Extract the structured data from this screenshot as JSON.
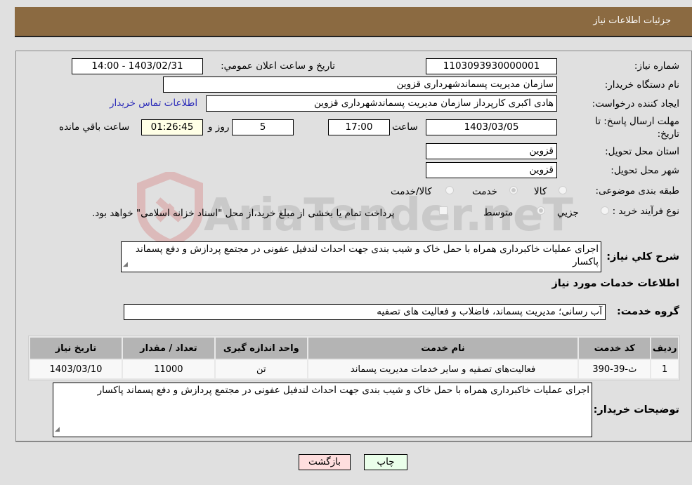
{
  "header": {
    "title": "جزئیات اطلاعات نیاز"
  },
  "form": {
    "need_number": {
      "label": "شماره نیاز:",
      "value": "1103093930000001"
    },
    "announce": {
      "label": "تاریخ و ساعت اعلان عمومي:",
      "value": "1403/02/31 - 14:00"
    },
    "buyer_org": {
      "label": "نام دستگاه خریدار:",
      "value": "سازمان مدیریت پسماندشهرداری قزوین"
    },
    "creator": {
      "label": "ایجاد کننده درخواست:",
      "value": "هادی اکبری کارپرداز سازمان مدیریت پسماندشهرداری قزوین",
      "contact_link": "اطلاعات تماس خریدار"
    },
    "deadline": {
      "label_line1": "مهلت ارسال پاسخ: تا",
      "label_line2": "تاریخ:",
      "date": "1403/03/05",
      "time_label": "ساعت",
      "time": "17:00",
      "days": "5",
      "days_label": "روز و",
      "remaining": "01:26:45",
      "remaining_label": "ساعت باقي مانده"
    },
    "province": {
      "label": "استان محل تحویل:",
      "value": "قزوین"
    },
    "city": {
      "label": "شهر محل تحویل:",
      "value": "قزوین"
    },
    "category": {
      "label": "طبقه بندی موضوعی:",
      "options": [
        "کالا",
        "خدمت",
        "کالا/خدمت"
      ],
      "selected": "خدمت"
    },
    "purchase_type": {
      "label": "نوع فرآیند خرید :",
      "options": [
        "جزیي",
        "متوسط"
      ],
      "selected": "متوسط",
      "treasury_note": "پرداخت تمام یا بخشی از مبلغ خرید،از محل \"اسناد خزانه اسلامی\" خواهد بود."
    },
    "description": {
      "label": "شرح کلي نیاز:",
      "value": "اجرای عملیات خاکبرداری همراه با حمل خاک و شیب بندی جهت احداث  لندفیل عفونی در مجتمع پردازش و دفع پسماند  پاکسار"
    },
    "services_title": "اطلاعات خدمات مورد نیاز",
    "service_group": {
      "label": "گروه خدمت:",
      "value": "آب رسانی؛ مدیریت پسماند، فاضلاب و فعالیت های تصفیه"
    }
  },
  "table": {
    "headers": [
      "ردیف",
      "کد خدمت",
      "نام خدمت",
      "واحد اندازه گیری",
      "تعداد / مقدار",
      "تاریخ نیاز"
    ],
    "rows": [
      [
        "1",
        "ث-39-390",
        "فعالیت‌های تصفیه و سایر خدمات مدیریت پسماند",
        "تن",
        "11000",
        "1403/03/10"
      ]
    ]
  },
  "buyer_notes": {
    "label": "توضیحات خریدار:",
    "value": "اجرای عملیات خاکبرداری همراه با حمل خاک و شیب بندی جهت احداث  لندفیل عفونی در مجتمع پردازش و دفع پسماند پاکسار"
  },
  "buttons": {
    "print": "چاپ",
    "back": "بازگشت"
  },
  "watermark": {
    "text": "AriaTender.neT"
  },
  "colors": {
    "header_bg": "#8b6a41",
    "print_bg": "#eaffea",
    "back_bg": "#ffdede",
    "link": "#2a2ab8"
  }
}
